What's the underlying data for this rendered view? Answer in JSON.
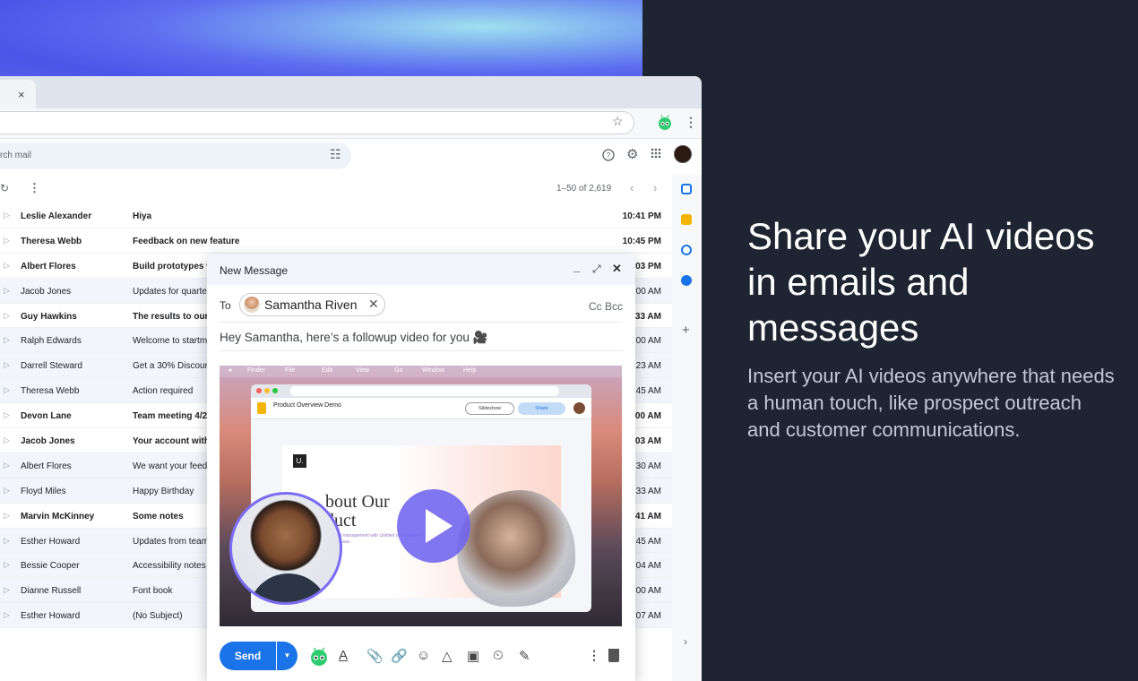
{
  "marketing": {
    "headline": "Share your AI videos in emails and messages",
    "subtext": "Insert your AI videos anywhere that needs a human touch, like prospect outreach and customer communications."
  },
  "browser": {
    "tab_close": "×"
  },
  "gmail": {
    "search_placeholder": "rch mail",
    "pager": "1–50 of 2,619"
  },
  "emails": [
    {
      "sender": "Leslie Alexander",
      "subject": "Hiya",
      "time": "10:41 PM",
      "unread": true
    },
    {
      "sender": "Theresa Webb",
      "subject": "Feedback on new feature",
      "time": "10:45 PM",
      "unread": true
    },
    {
      "sender": "Albert Flores",
      "subject": "Build prototypes w",
      "time": "03 PM",
      "unread": true
    },
    {
      "sender": "Jacob Jones",
      "subject": "Updates for quarte",
      "time": "00 AM",
      "unread": false
    },
    {
      "sender": "Guy Hawkins",
      "subject": "The results to our",
      "time": "33 AM",
      "unread": true
    },
    {
      "sender": "Ralph Edwards",
      "subject": "Welcome to startm",
      "time": "00 AM",
      "unread": false
    },
    {
      "sender": "Darrell Steward",
      "subject": "Get a 30% Discoun",
      "time": "23 AM",
      "unread": false
    },
    {
      "sender": "Theresa Webb",
      "subject": "Action required",
      "time": "45 AM",
      "unread": false
    },
    {
      "sender": "Devon Lane",
      "subject": "Team meeting 4/2",
      "time": "00 AM",
      "unread": true
    },
    {
      "sender": "Jacob Jones",
      "subject": "Your account with",
      "time": "03 AM",
      "unread": true
    },
    {
      "sender": "Albert Flores",
      "subject": "We want your feed",
      "time": "30 AM",
      "unread": false
    },
    {
      "sender": "Floyd Miles",
      "subject": "Happy Birthday",
      "time": "33 AM",
      "unread": false
    },
    {
      "sender": "Marvin McKinney",
      "subject": "Some notes",
      "time": "41 AM",
      "unread": true
    },
    {
      "sender": "Esther Howard",
      "subject": "Updates from team",
      "time": "45 AM",
      "unread": false
    },
    {
      "sender": "Bessie Cooper",
      "subject": "Accessibility notes",
      "time": "04 AM",
      "unread": false
    },
    {
      "sender": "Dianne Russell",
      "subject": "Font book",
      "time": "00 AM",
      "unread": false
    },
    {
      "sender": "Esther Howard",
      "subject": "(No Subject)",
      "time": "07 AM",
      "unread": false
    }
  ],
  "compose": {
    "title": "New Message",
    "to_label": "To",
    "recipient": "Samantha Riven",
    "cc_bcc": "Cc Bcc",
    "body": "Hey Samantha, here’s a followup video for you 🎥",
    "send_label": "Send"
  },
  "video": {
    "menu": [
      "Finder",
      "File",
      "Edit",
      "View",
      "Go",
      "Window",
      "Help"
    ],
    "doc_title": "Product Overview Demo",
    "slideshow_label": "Slideshow",
    "share_label": "Share",
    "slide_logo": "U.",
    "slide_heading": "bout Our\nduct",
    "slide_body": "oduct management with Untitled your projects with ease."
  },
  "colors": {
    "background": "#1f2433",
    "send": "#1a73e8",
    "play_button": "#6e64f0",
    "face_ring": "#7b6cf4"
  }
}
